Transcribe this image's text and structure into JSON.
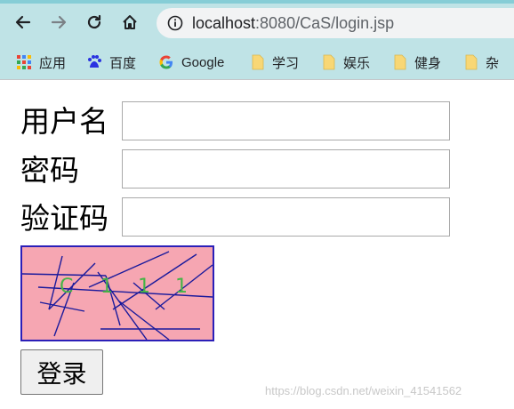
{
  "browser": {
    "url_host": "localhost",
    "url_rest": ":8080/CaS/login.jsp",
    "nav": {
      "back_icon": "back-arrow-icon",
      "forward_icon": "forward-arrow-icon",
      "reload_icon": "reload-icon",
      "home_icon": "home-icon"
    },
    "bookmarks": [
      {
        "label": "应用",
        "icon": "apps-grid-icon"
      },
      {
        "label": "百度",
        "icon": "baidu-paw-icon"
      },
      {
        "label": "Google",
        "icon": "google-g-icon"
      },
      {
        "label": "学习",
        "icon": "folder-icon"
      },
      {
        "label": "娱乐",
        "icon": "folder-icon"
      },
      {
        "label": "健身",
        "icon": "folder-icon"
      },
      {
        "label": "杂",
        "icon": "folder-icon"
      }
    ]
  },
  "form": {
    "username_label": "用户名",
    "password_label": "密码",
    "captcha_label": "验证码",
    "username_value": "",
    "password_value": "",
    "captcha_value": "",
    "captcha_chars": [
      "C",
      "1",
      "1",
      "1"
    ],
    "submit_label": "登录"
  },
  "watermark": "https://blog.csdn.net/weixin_41541562",
  "colors": {
    "chrome_bg": "#bfe3e6",
    "captcha_bg": "#f6a6b2",
    "captcha_border": "#2b1fb8",
    "captcha_text": "#46b446"
  }
}
